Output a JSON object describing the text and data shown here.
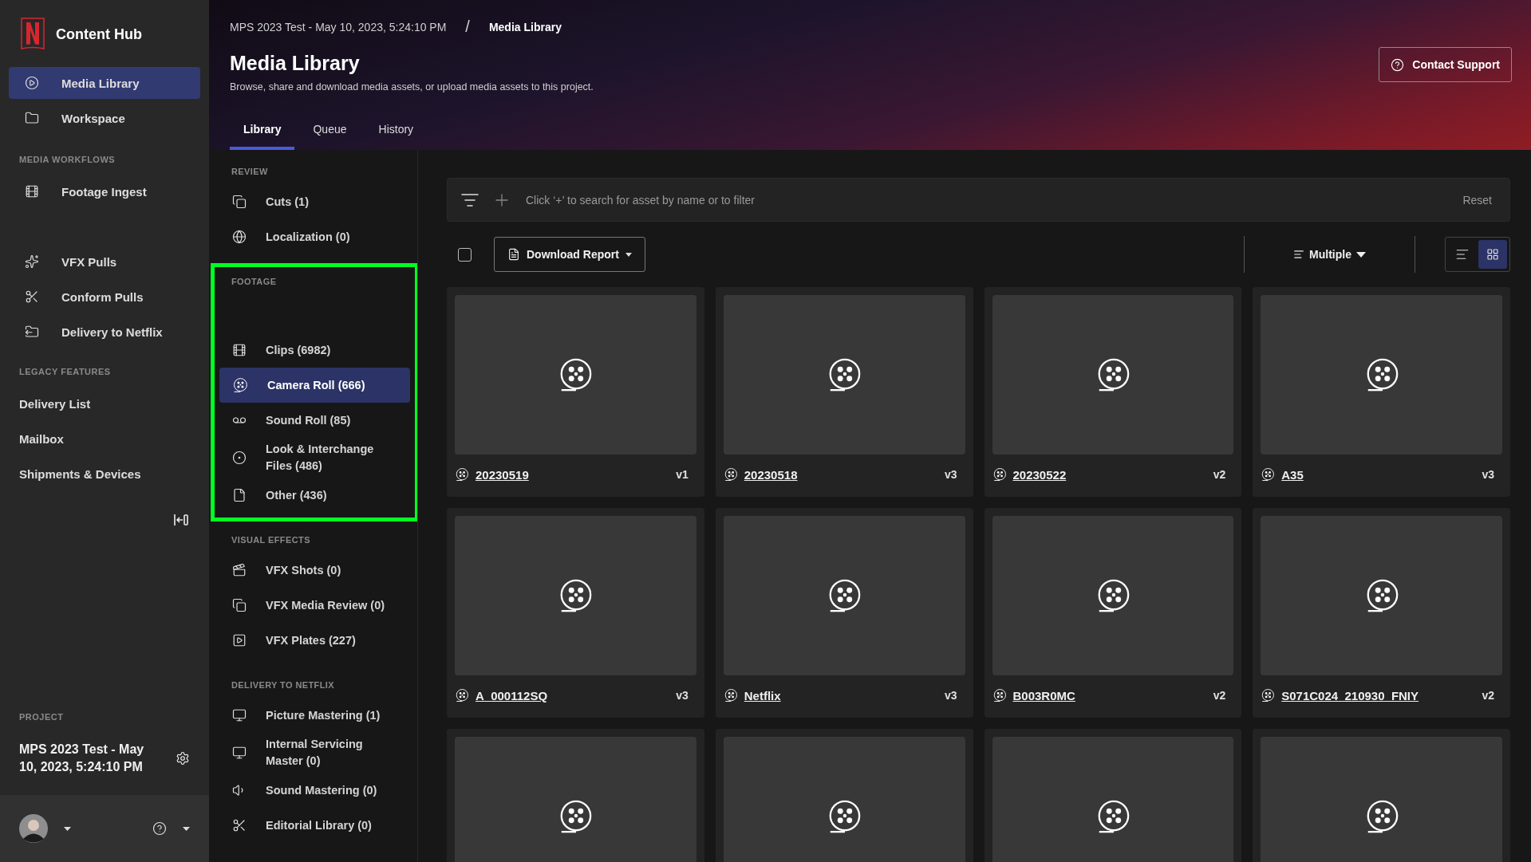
{
  "app": {
    "name": "Content Hub"
  },
  "sidebar": {
    "nav": [
      {
        "label": "Media Library",
        "selected": true
      },
      {
        "label": "Workspace",
        "selected": false
      }
    ],
    "sections": [
      {
        "title": "MEDIA WORKFLOWS",
        "items": [
          {
            "label": "Footage Ingest"
          },
          {
            "label": "VFX Pulls"
          },
          {
            "label": "Conform Pulls"
          },
          {
            "label": "Delivery to Netflix"
          }
        ]
      },
      {
        "title": "LEGACY FEATURES",
        "items": [
          {
            "label": "Delivery List"
          },
          {
            "label": "Mailbox"
          },
          {
            "label": "Shipments & Devices"
          }
        ]
      }
    ],
    "project": {
      "label": "PROJECT",
      "name": "MPS 2023 Test - May 10, 2023, 5:24:10 PM"
    }
  },
  "header": {
    "breadcrumb": [
      "MPS 2023 Test - May 10, 2023, 5:24:10 PM",
      "/",
      "Media Library"
    ],
    "title": "Media Library",
    "subtitle": "Browse, share and download media assets, or upload media assets to this project.",
    "contact_button": "Contact Support",
    "tabs": [
      {
        "label": "Library",
        "selected": true
      },
      {
        "label": "Queue",
        "selected": false
      },
      {
        "label": "History",
        "selected": false
      }
    ]
  },
  "categories": [
    {
      "title": "REVIEW",
      "highlighted": false,
      "items": [
        {
          "label": "Cuts (1)",
          "selected": false
        },
        {
          "label": "Localization (0)",
          "selected": false
        }
      ]
    },
    {
      "title": "FOOTAGE",
      "highlighted": true,
      "items": [
        {
          "label": "Clips (6982)",
          "selected": false
        },
        {
          "label": "Camera Roll (666)",
          "selected": true
        },
        {
          "label": "Sound Roll (85)",
          "selected": false
        },
        {
          "label": "Look & Interchange Files (486)",
          "selected": false
        },
        {
          "label": "Other (436)",
          "selected": false
        }
      ]
    },
    {
      "title": "VISUAL EFFECTS",
      "highlighted": false,
      "items": [
        {
          "label": "VFX Shots (0)",
          "selected": false
        },
        {
          "label": "VFX Media Review (0)",
          "selected": false
        },
        {
          "label": "VFX Plates (227)",
          "selected": false
        }
      ]
    },
    {
      "title": "DELIVERY TO NETFLIX",
      "highlighted": false,
      "items": [
        {
          "label": "Picture Mastering (1)",
          "selected": false
        },
        {
          "label": "Internal Servicing Master (0)",
          "selected": false
        },
        {
          "label": "Sound Mastering (0)",
          "selected": false
        },
        {
          "label": "Editorial Library (0)",
          "selected": false
        }
      ]
    }
  ],
  "search": {
    "placeholder": "Click ‘+’ to search for asset by name or to filter",
    "reset": "Reset"
  },
  "toolbar": {
    "select_all": {
      "checked": false
    },
    "download_button": "Download Report",
    "sort": "Multiple",
    "views": [
      {
        "selected": false
      },
      {
        "selected": true
      }
    ]
  },
  "assets": [
    {
      "kind": "full",
      "name": "20230519",
      "version": "v1"
    },
    {
      "kind": "full",
      "name": "20230518",
      "version": "v3"
    },
    {
      "kind": "full",
      "name": "20230522",
      "version": "v2"
    },
    {
      "kind": "full",
      "name": "A35",
      "version": "v3"
    },
    {
      "kind": "full",
      "name": "A_000112SQ",
      "version": "v3"
    },
    {
      "kind": "full",
      "name": "Netflix",
      "version": "v3"
    },
    {
      "kind": "full",
      "name": "B003R0MC",
      "version": "v2"
    },
    {
      "kind": "full",
      "name": "S071C024_210930_FNIY",
      "version": "v2"
    },
    {
      "kind": "partial"
    },
    {
      "kind": "partial"
    },
    {
      "kind": "partial"
    },
    {
      "kind": "partial"
    }
  ]
}
